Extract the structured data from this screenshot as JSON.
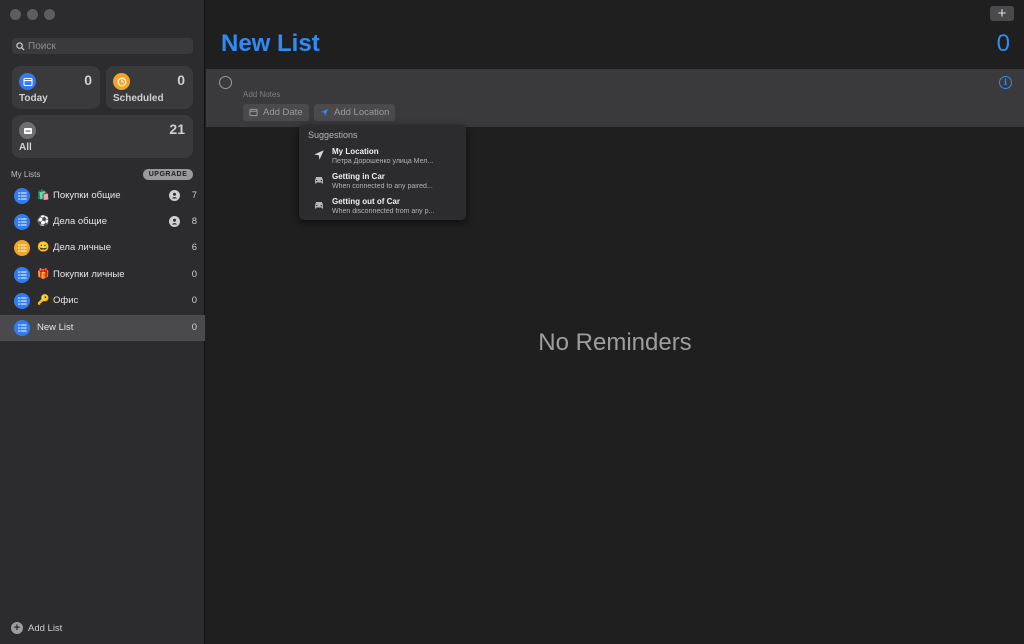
{
  "sidebar": {
    "search_placeholder": "Поиск",
    "smart_lists": [
      {
        "label": "Today",
        "count": "0",
        "icon": "calendar-icon",
        "color": "#2f7cf6"
      },
      {
        "label": "Scheduled",
        "count": "0",
        "icon": "clock-icon",
        "color": "#f5a524"
      },
      {
        "label": "All",
        "count": "21",
        "icon": "tray-icon",
        "color": "#6e6e70"
      }
    ],
    "my_lists_header": "My Lists",
    "upgrade_label": "UPGRADE",
    "lists": [
      {
        "emoji": "🛍️",
        "name": "Покупки общие",
        "count": "7",
        "shared": true,
        "color": "#2f7cf6"
      },
      {
        "emoji": "⚽",
        "name": "Дела общие",
        "count": "8",
        "shared": true,
        "color": "#2f7cf6"
      },
      {
        "emoji": "😀",
        "name": "Дела личные",
        "count": "6",
        "shared": false,
        "color": "#f5a524"
      },
      {
        "emoji": "🎁",
        "name": "Покупки личные",
        "count": "0",
        "shared": false,
        "color": "#2f7cf6"
      },
      {
        "emoji": "🔑",
        "name": "Офис",
        "count": "0",
        "shared": false,
        "color": "#2f7cf6"
      },
      {
        "emoji": "",
        "name": "New List",
        "count": "0",
        "shared": false,
        "color": "#2f7cf6",
        "selected": true
      }
    ],
    "add_list_label": "Add List"
  },
  "main": {
    "plus_label": "+",
    "title": "New List",
    "total": "0",
    "add_notes_placeholder": "Add Notes",
    "add_date_label": "Add Date",
    "add_location_label": "Add Location",
    "empty_label": "No Reminders",
    "accent_color": "#2f8bf5"
  },
  "suggestions": {
    "header": "Suggestions",
    "items": [
      {
        "title": "My Location",
        "subtitle": "Петра Дорошенко улица Мел...",
        "icon": "location-arrow-icon"
      },
      {
        "title": "Getting in Car",
        "subtitle": "When connected to any paired...",
        "icon": "car-icon"
      },
      {
        "title": "Getting out of Car",
        "subtitle": "When disconnected from any p...",
        "icon": "car-icon"
      }
    ]
  }
}
